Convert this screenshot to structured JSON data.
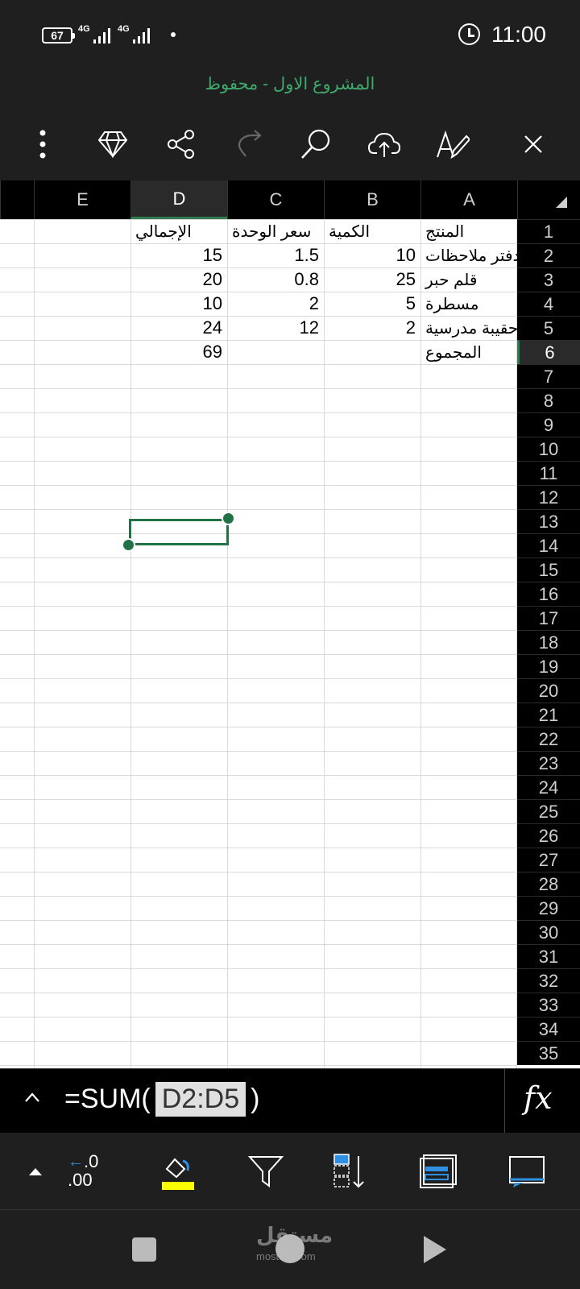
{
  "status": {
    "battery": "67",
    "network1": "4G",
    "network2": "4G",
    "time": "11:00"
  },
  "document": {
    "title": "المشروع الاول - محفوظ"
  },
  "toolbar": {
    "icons": [
      "more-icon",
      "diamond-icon",
      "share-icon",
      "redo-icon",
      "search-icon",
      "cloud-upload-icon",
      "pen-icon",
      "close-icon"
    ]
  },
  "sheet": {
    "columns": [
      "A",
      "B",
      "C",
      "D",
      "E"
    ],
    "active_column": "D",
    "active_row": "6",
    "rows": [
      "1",
      "2",
      "3",
      "4",
      "5",
      "6",
      "7",
      "8",
      "9",
      "10",
      "11",
      "12",
      "13",
      "14",
      "15",
      "16",
      "17",
      "18",
      "19",
      "20",
      "21",
      "22",
      "23",
      "24",
      "25",
      "26",
      "27",
      "28",
      "29",
      "30",
      "31",
      "32",
      "33",
      "34",
      "35"
    ],
    "cells": {
      "A1": "المنتج",
      "B1": "الكمية",
      "C1": "سعر الوحدة",
      "D1": "الإجمالي",
      "A2": "دفتر ملاحظات",
      "B2": "10",
      "C2": "1.5",
      "D2": "15",
      "A3": "قلم حبر",
      "B3": "25",
      "C3": "0.8",
      "D3": "20",
      "A4": "مسطرة",
      "B4": "5",
      "C4": "2",
      "D4": "10",
      "A5": "حقيبة مدرسية",
      "B5": "2",
      "C5": "12",
      "D5": "24",
      "A6": "المجموع",
      "D6": "69"
    }
  },
  "formula_bar": {
    "prefix": "=SUM(",
    "reference": "D2:D5",
    "suffix": ")",
    "fx_label": "fx"
  },
  "bottom_toolbar": {
    "decimal_top": ".0",
    "decimal_bottom": ".00",
    "fill_color": "#ffff00"
  },
  "watermark": {
    "text": "مستقل",
    "sub": "mostaql.com"
  },
  "colors": {
    "accent": "#217346",
    "title_green": "#3fa96b"
  }
}
